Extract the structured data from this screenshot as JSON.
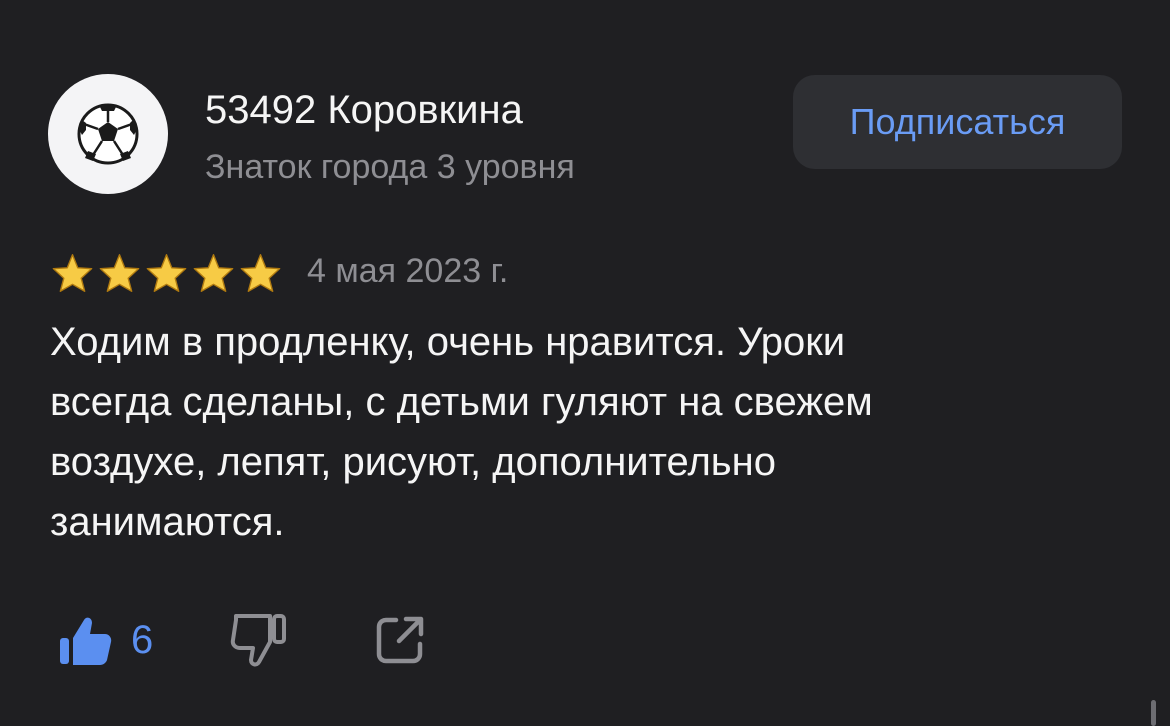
{
  "review": {
    "author": {
      "name": "53492 Коровкина",
      "status": "Знаток города 3 уровня",
      "avatar_icon": "soccer-ball-icon"
    },
    "subscribe_label": "Подписаться",
    "rating": 5,
    "rating_max": 5,
    "date": "4 мая 2023 г.",
    "text_lines": [
      "Ходим в продленку, очень нравится. Уроки",
      "всегда сделаны, с детьми гуляют на свежем",
      "воздухе, лепят, рисуют, дополнительно",
      "занимаются."
    ],
    "likes": "6",
    "icons": {
      "like": "thumbs-up-icon",
      "dislike": "thumbs-down-icon",
      "share": "share-icon"
    }
  },
  "colors": {
    "background": "#1f1f22",
    "accent": "#5b8ff0",
    "star": "#f7cb45",
    "muted_text": "#8e8e93",
    "button_bg": "#2e2f33"
  }
}
